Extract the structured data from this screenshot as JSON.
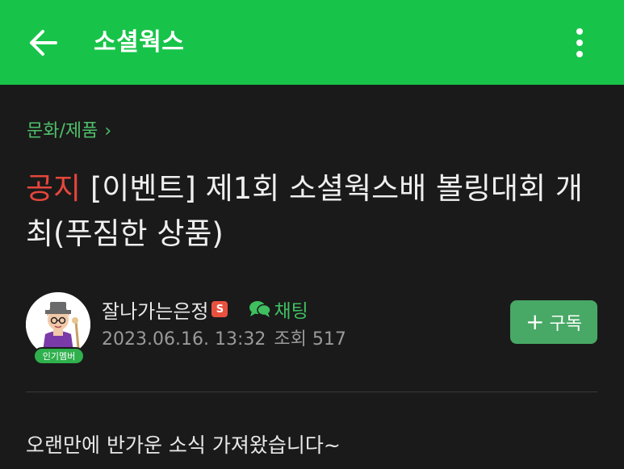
{
  "header": {
    "title": "소셜웍스",
    "back_icon": "arrow-left-icon",
    "more_icon": "more-vertical-icon",
    "bg_color": "#17c449"
  },
  "breadcrumb": {
    "label": "문화/제품",
    "chevron": "›"
  },
  "post": {
    "prefix": "공지",
    "title": "[이벤트] 제1회 소셜웍스배 볼링대회 개최(푸짐한 상품)",
    "prefix_color": "#e5463c"
  },
  "author": {
    "name": "잘나가는은정",
    "staff_badge": "S",
    "member_badge": "인기멤버",
    "chat_label": "채팅",
    "date": "2023.06.16. 13:32",
    "views": "조회 517"
  },
  "subscribe": {
    "plus": "+",
    "label": "구독"
  },
  "content": {
    "first_line": "오랜만에 반가운 소식 가져왔습니다~"
  }
}
